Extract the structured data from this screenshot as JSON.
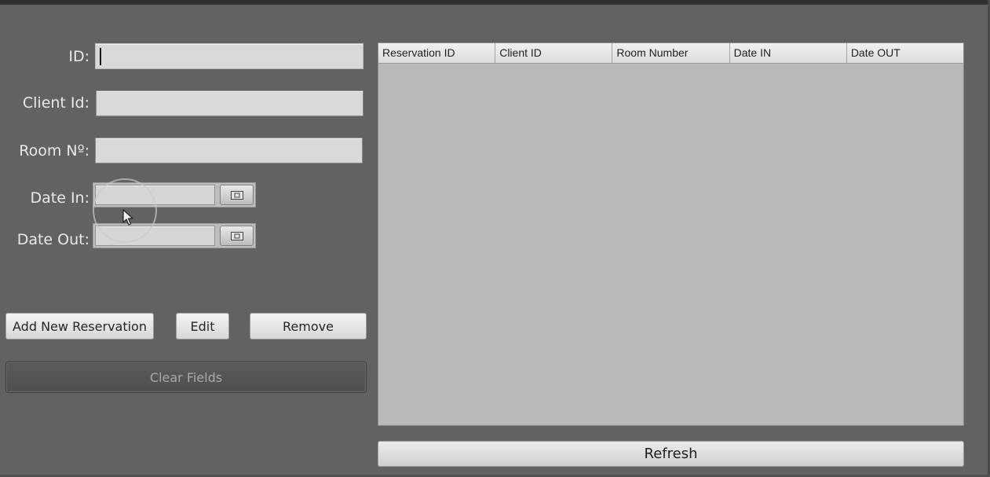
{
  "form": {
    "id_label": "ID:",
    "id_value": "",
    "client_label": "Client Id:",
    "client_value": "",
    "room_label": "Room Nº:",
    "room_value": "",
    "date_in_label": "Date In:",
    "date_in_value": "",
    "date_out_label": "Date Out:",
    "date_out_value": ""
  },
  "buttons": {
    "add": "Add New Reservation",
    "edit": "Edit",
    "remove": "Remove",
    "clear": "Clear Fields",
    "refresh": "Refresh"
  },
  "table": {
    "columns": [
      "Reservation ID",
      "Client ID",
      "Room Number",
      "Date IN",
      "Date OUT"
    ],
    "rows": []
  },
  "icons": {
    "calendar": "calendar-icon",
    "pointer": "mouse-pointer-icon"
  },
  "colors": {
    "background": "#626262",
    "table_body": "#b9b9b9",
    "field": "#d9d9d9"
  }
}
